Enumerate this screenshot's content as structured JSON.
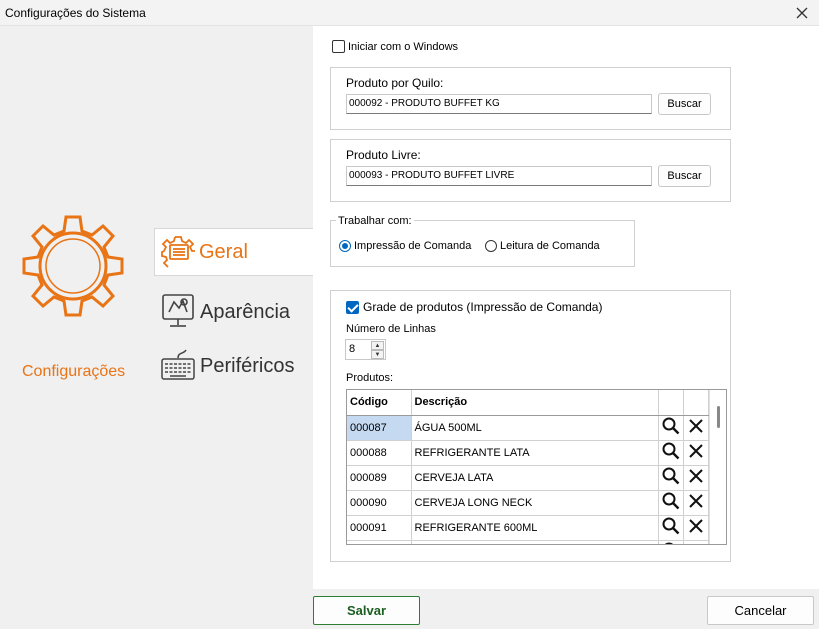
{
  "window": {
    "title": "Configurações do Sistema"
  },
  "sidebar": {
    "main_label": "Configurações",
    "accent_color": "#e87416",
    "items": [
      {
        "label": "Geral",
        "icon": "settings-form-icon",
        "selected": true
      },
      {
        "label": "Aparência",
        "icon": "appearance-monitor-icon",
        "selected": false
      },
      {
        "label": "Periféricos",
        "icon": "keyboard-icon",
        "selected": false
      }
    ]
  },
  "general": {
    "start_with_windows": {
      "label": "Iniciar com o Windows",
      "checked": false
    },
    "produto_quilo": {
      "label": "Produto por Quilo:",
      "value": "000092 - PRODUTO BUFFET KG",
      "button": "Buscar"
    },
    "produto_livre": {
      "label": "Produto Livre:",
      "value": "000093 - PRODUTO BUFFET LIVRE",
      "button": "Buscar"
    },
    "trabalhar_com": {
      "label": "Trabalhar com:",
      "options": [
        {
          "label": "Impressão de Comanda",
          "selected": true
        },
        {
          "label": "Leitura de Comanda",
          "selected": false
        }
      ]
    },
    "grade": {
      "label": "Grade de produtos (Impressão de Comanda)",
      "checked": true,
      "num_linhas_label": "Número de Linhas",
      "num_linhas_value": "8",
      "produtos_label": "Produtos:",
      "columns": [
        "Código",
        "Descrição"
      ],
      "rows": [
        {
          "codigo": "000087",
          "descricao": "ÁGUA 500ML"
        },
        {
          "codigo": "000088",
          "descricao": "REFRIGERANTE LATA"
        },
        {
          "codigo": "000089",
          "descricao": "CERVEJA LATA"
        },
        {
          "codigo": "000090",
          "descricao": "CERVEJA LONG NECK"
        },
        {
          "codigo": "000091",
          "descricao": "REFRIGERANTE 600ML"
        }
      ]
    }
  },
  "footer": {
    "save": "Salvar",
    "cancel": "Cancelar"
  }
}
